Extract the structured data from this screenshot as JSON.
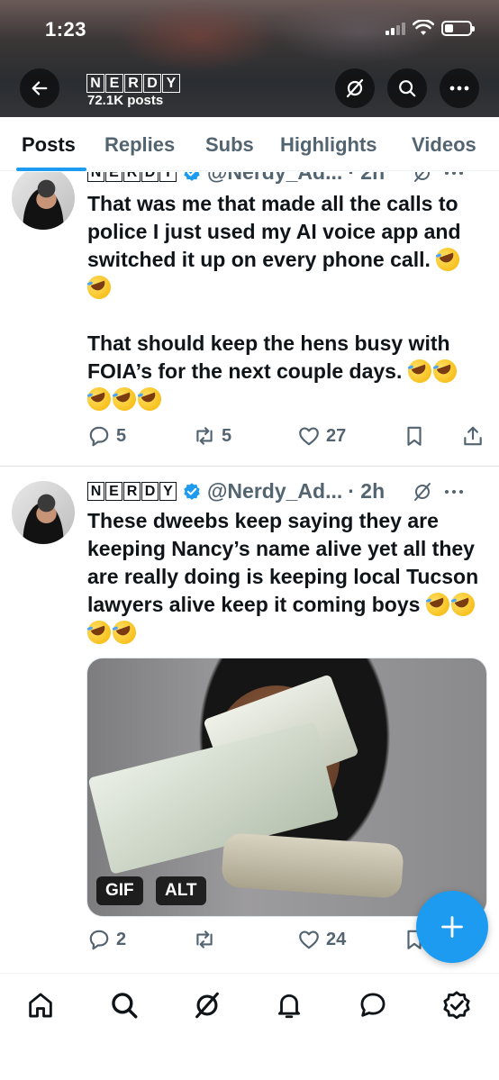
{
  "status_bar": {
    "time": "1:23"
  },
  "header": {
    "name_letters": [
      "N",
      "E",
      "R",
      "D",
      "Y"
    ],
    "posts_count": "72.1K posts",
    "buttons": [
      "back-arrow-icon",
      "grok-icon",
      "search-icon",
      "more-icon"
    ]
  },
  "tabs": [
    {
      "label": "Posts",
      "active": true
    },
    {
      "label": "Replies",
      "active": false
    },
    {
      "label": "Subs",
      "active": false
    },
    {
      "label": "Highlights",
      "active": false
    },
    {
      "label": "Videos",
      "active": false
    }
  ],
  "posts": [
    {
      "name_letters": [
        "N",
        "E",
        "R",
        "D",
        "Y"
      ],
      "handle": "@Nerdy_Ad...",
      "time": "· 2h",
      "text_line1": "That was me that made all the calls to police I just used my AI voice app and switched it up on every phone call. ",
      "text_line2": "That should keep the hens busy with FOIA’s for the next couple days. ",
      "replies": "5",
      "reposts": "5",
      "likes": "27"
    },
    {
      "name_letters": [
        "N",
        "E",
        "R",
        "D",
        "Y"
      ],
      "handle": "@Nerdy_Ad...",
      "time": "· 2h",
      "text": "These dweebs keep saying they are keeping Nancy’s name alive yet all they are really doing is keeping local Tucson lawyers alive keep it coming boys ",
      "media_badges": [
        "GIF",
        "ALT"
      ],
      "replies": "2",
      "reposts": "",
      "likes": "24"
    }
  ],
  "bottom_nav": [
    "home-icon",
    "search-icon",
    "grok-icon",
    "notifications-icon",
    "messages-icon",
    "verified-icon"
  ],
  "colors": {
    "accent": "#1d9bf0",
    "text": "#0f1419",
    "muted": "#536471"
  }
}
